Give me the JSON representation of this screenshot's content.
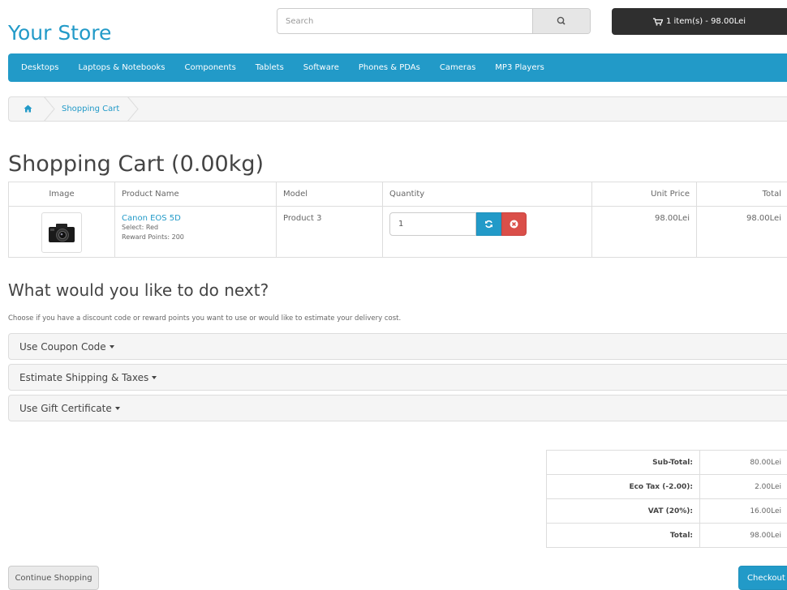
{
  "header": {
    "logo": "Your Store",
    "search_placeholder": "Search",
    "cart_summary": "1 item(s) - 98.00Lei"
  },
  "menu": [
    "Desktops",
    "Laptops & Notebooks",
    "Components",
    "Tablets",
    "Software",
    "Phones & PDAs",
    "Cameras",
    "MP3 Players"
  ],
  "breadcrumb": {
    "current": "Shopping Cart"
  },
  "page_title": "Shopping Cart  (0.00kg)",
  "cart_table": {
    "headers": {
      "image": "Image",
      "name": "Product Name",
      "model": "Model",
      "quantity": "Quantity",
      "unit_price": "Unit Price",
      "total": "Total"
    },
    "rows": [
      {
        "name": "Canon EOS 5D",
        "option": "Select: Red",
        "reward": "Reward Points: 200",
        "model": "Product 3",
        "quantity": "1",
        "unit_price": "98.00Lei",
        "total": "98.00Lei"
      }
    ]
  },
  "next_section": {
    "title": "What would you like to do next?",
    "intro": "Choose if you have a discount code or reward points you want to use or would like to estimate your delivery cost.",
    "panels": [
      "Use Coupon Code",
      "Estimate Shipping & Taxes",
      "Use Gift Certificate"
    ]
  },
  "totals": [
    {
      "label": "Sub-Total:",
      "value": "80.00Lei"
    },
    {
      "label": "Eco Tax (-2.00):",
      "value": "2.00Lei"
    },
    {
      "label": "VAT (20%):",
      "value": "16.00Lei"
    },
    {
      "label": "Total:",
      "value": "98.00Lei"
    }
  ],
  "buttons": {
    "continue": "Continue Shopping",
    "checkout": "Checkout"
  },
  "colors": {
    "accent": "#229ac8",
    "dark": "#2f2f2f",
    "danger": "#da4f49"
  }
}
